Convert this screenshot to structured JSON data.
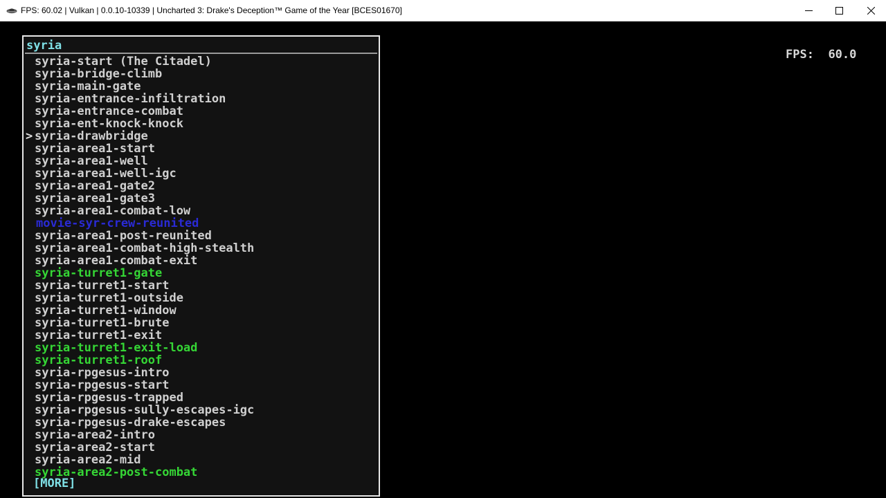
{
  "window": {
    "title": "FPS: 60.02 | Vulkan | 0.0.10-10339 | Uncharted 3: Drake's Deception™ Game of the Year [BCES01670]",
    "icon": "rpcs3-app-icon",
    "buttons": {
      "minimize": "minimize-icon",
      "maximize": "maximize-icon",
      "close": "close-icon"
    }
  },
  "overlay": {
    "fps_label": "FPS:",
    "fps_value": "60.0"
  },
  "menu": {
    "search": "syria",
    "more": "[MORE]",
    "items": [
      {
        "label": "syria-start (The Citadel)",
        "style": "normal"
      },
      {
        "label": "syria-bridge-climb",
        "style": "normal"
      },
      {
        "label": "syria-main-gate",
        "style": "normal"
      },
      {
        "label": "syria-entrance-infiltration",
        "style": "normal"
      },
      {
        "label": "syria-entrance-combat",
        "style": "normal"
      },
      {
        "label": "syria-ent-knock-knock",
        "style": "normal"
      },
      {
        "label": "syria-drawbridge",
        "style": "selected"
      },
      {
        "label": "syria-area1-start",
        "style": "normal"
      },
      {
        "label": "syria-area1-well",
        "style": "normal"
      },
      {
        "label": "syria-area1-well-igc",
        "style": "normal"
      },
      {
        "label": "syria-area1-gate2",
        "style": "normal"
      },
      {
        "label": "syria-area1-gate3",
        "style": "normal"
      },
      {
        "label": "syria-area1-combat-low",
        "style": "normal"
      },
      {
        "label": "movie-syr-crew-reunited",
        "style": "blue"
      },
      {
        "label": "syria-area1-post-reunited",
        "style": "normal"
      },
      {
        "label": "syria-area1-combat-high-stealth",
        "style": "normal"
      },
      {
        "label": "syria-area1-combat-exit",
        "style": "normal"
      },
      {
        "label": "syria-turret1-gate",
        "style": "green"
      },
      {
        "label": "syria-turret1-start",
        "style": "normal"
      },
      {
        "label": "syria-turret1-outside",
        "style": "normal"
      },
      {
        "label": "syria-turret1-window",
        "style": "normal"
      },
      {
        "label": "syria-turret1-brute",
        "style": "normal"
      },
      {
        "label": "syria-turret1-exit",
        "style": "normal"
      },
      {
        "label": "syria-turret1-exit-load",
        "style": "green"
      },
      {
        "label": "syria-turret1-roof",
        "style": "green"
      },
      {
        "label": "syria-rpgesus-intro",
        "style": "normal"
      },
      {
        "label": "syria-rpgesus-start",
        "style": "normal"
      },
      {
        "label": "syria-rpgesus-trapped",
        "style": "normal"
      },
      {
        "label": "syria-rpgesus-sully-escapes-igc",
        "style": "normal"
      },
      {
        "label": "syria-rpgesus-drake-escapes",
        "style": "normal"
      },
      {
        "label": "syria-area2-intro",
        "style": "normal"
      },
      {
        "label": "syria-area2-start",
        "style": "normal"
      },
      {
        "label": "syria-area2-mid",
        "style": "normal"
      },
      {
        "label": "syria-area2-post-combat",
        "style": "green"
      }
    ]
  },
  "colors": {
    "normal_text": "#d0d0d0",
    "green_text": "#35d635",
    "blue_text": "#2a2ad4",
    "search_text": "#7fe0e6"
  }
}
